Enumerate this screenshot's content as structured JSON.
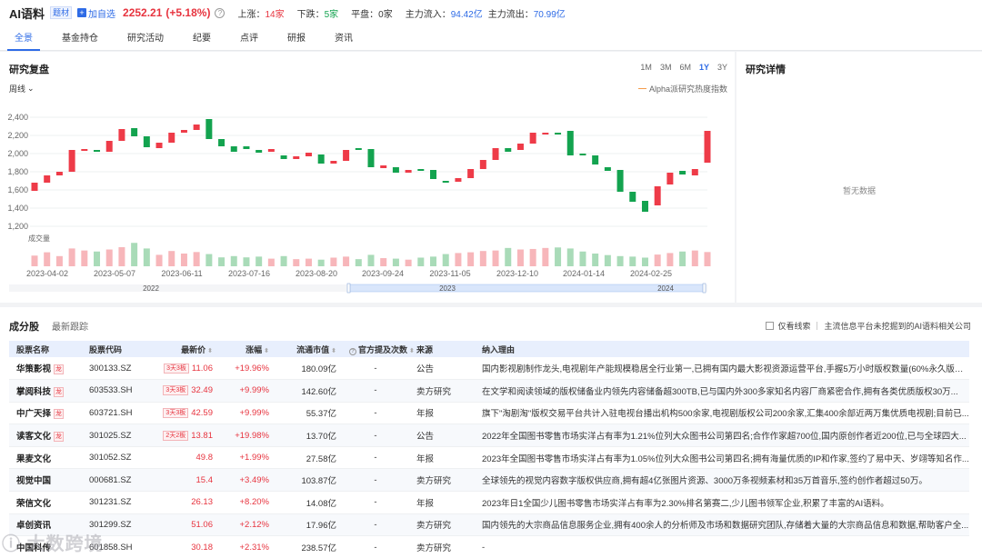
{
  "header": {
    "title": "AI语料",
    "badge": "题材",
    "add_watch": "加自选",
    "price": "2252.21",
    "change": "(+5.18%)",
    "stats": {
      "up_label": "上涨：",
      "up_value": "14家",
      "down_label": "下跌：",
      "down_value": "5家",
      "flat_label": "平盘：",
      "flat_value": "0家",
      "inflow_label": "主力流入：",
      "inflow_value": "94.42亿",
      "outflow_label": "主力流出：",
      "outflow_value": "70.99亿"
    }
  },
  "tabs": [
    "全景",
    "基金持仓",
    "研究活动",
    "纪要",
    "点评",
    "研报",
    "资讯"
  ],
  "review": {
    "title": "研究复盘",
    "period": "周线",
    "ranges": [
      "1M",
      "3M",
      "6M",
      "1Y",
      "3Y"
    ],
    "active_range": "1Y",
    "legend": "Alpha派研究热度指数",
    "volume_label": "成交量"
  },
  "detail": {
    "title": "研究详情",
    "empty": "暂无数据"
  },
  "chart_data": {
    "type": "candlestick",
    "yticks": [
      "2,400",
      "2,200",
      "2,000",
      "1,800",
      "1,600",
      "1,400",
      "1,200"
    ],
    "ylim": [
      1200,
      2400
    ],
    "xticks": [
      "2023-04-02",
      "2023-05-07",
      "2023-06-11",
      "2023-07-16",
      "2023-08-20",
      "2023-09-24",
      "2023-11-05",
      "2023-12-10",
      "2024-01-14",
      "2024-02-25"
    ],
    "years": [
      "2022",
      "2023",
      "2024"
    ],
    "candles": [
      [
        1590,
        1680
      ],
      [
        1680,
        1760
      ],
      [
        1760,
        1800
      ],
      [
        1800,
        2040
      ],
      [
        2040,
        2050
      ],
      [
        2040,
        2020
      ],
      [
        2020,
        2140
      ],
      [
        2140,
        2270
      ],
      [
        2280,
        2190
      ],
      [
        2190,
        2070
      ],
      [
        2060,
        2120
      ],
      [
        2120,
        2230
      ],
      [
        2230,
        2260
      ],
      [
        2260,
        2320
      ],
      [
        2380,
        2160
      ],
      [
        2160,
        2080
      ],
      [
        2080,
        2020
      ],
      [
        2080,
        2050
      ],
      [
        2040,
        2010
      ],
      [
        2020,
        2050
      ],
      [
        1980,
        1940
      ],
      [
        1940,
        1970
      ],
      [
        1970,
        2010
      ],
      [
        1990,
        1890
      ],
      [
        1890,
        1920
      ],
      [
        1920,
        2040
      ],
      [
        2060,
        2040
      ],
      [
        2050,
        1850
      ],
      [
        1840,
        1870
      ],
      [
        1850,
        1790
      ],
      [
        1790,
        1820
      ],
      [
        1830,
        1810
      ],
      [
        1820,
        1720
      ],
      [
        1700,
        1680
      ],
      [
        1690,
        1730
      ],
      [
        1730,
        1830
      ],
      [
        1830,
        1930
      ],
      [
        1930,
        2060
      ],
      [
        2060,
        2020
      ],
      [
        2040,
        2110
      ],
      [
        2110,
        2230
      ],
      [
        2230,
        2230
      ],
      [
        2230,
        2210
      ],
      [
        2250,
        1980
      ],
      [
        2000,
        1980
      ],
      [
        1980,
        1880
      ],
      [
        1850,
        1810
      ],
      [
        1820,
        1580
      ],
      [
        1580,
        1470
      ],
      [
        1480,
        1360
      ],
      [
        1430,
        1640
      ],
      [
        1660,
        1790
      ],
      [
        1810,
        1770
      ],
      [
        1760,
        1830
      ],
      [
        1900,
        2250
      ]
    ],
    "volumes": [
      0.42,
      0.55,
      0.4,
      0.7,
      0.62,
      0.58,
      0.66,
      0.75,
      0.92,
      0.7,
      0.45,
      0.6,
      0.5,
      0.56,
      0.48,
      0.35,
      0.4,
      0.35,
      0.38,
      0.3,
      0.4,
      0.28,
      0.3,
      0.26,
      0.34,
      0.38,
      0.28,
      0.45,
      0.32,
      0.3,
      0.26,
      0.34,
      0.38,
      0.48,
      0.52,
      0.55,
      0.6,
      0.62,
      0.72,
      0.66,
      0.68,
      0.72,
      0.74,
      0.7,
      0.58,
      0.5,
      0.44,
      0.4,
      0.38,
      0.34,
      0.46,
      0.52,
      0.58,
      0.62,
      0.56
    ]
  },
  "comp": {
    "tab_active": "成分股",
    "tab_other": "最新跟踪",
    "checkbox_label": "仅看线索",
    "filter_text": "主流信息平台未挖掘到的AI语料相关公司",
    "headers": {
      "name": "股票名称",
      "code": "股票代码",
      "price": "最新价",
      "change": "涨幅",
      "cap": "流通市值",
      "mention": "官方提及次数",
      "source": "来源",
      "reason": "纳入理由"
    },
    "rows": [
      {
        "name": "华策影视",
        "tag": "龙",
        "code": "300133.SZ",
        "boards": "3天3板",
        "price": "11.06",
        "change": "+19.96%",
        "cap": "180.09亿",
        "mention": "-",
        "source": "公告",
        "reason": "国内影视剧制作龙头,电视剧年产能规模稳居全行业第一,已拥有国内最大影视资源运营平台,手握5万小时版权数量(60%永久版权..."
      },
      {
        "name": "掌阅科技",
        "tag": "龙",
        "code": "603533.SH",
        "boards": "3天3板",
        "price": "32.49",
        "change": "+9.99%",
        "cap": "142.60亿",
        "mention": "-",
        "source": "卖方研究",
        "reason": "在文学和阅读领域的版权储备业内领先内容储备超300TB,已与国内外300多家知名内容厂商紧密合作,拥有各类优质版权30万..."
      },
      {
        "name": "中广天择",
        "tag": "龙",
        "code": "603721.SH",
        "boards": "3天3板",
        "price": "42.59",
        "change": "+9.99%",
        "cap": "55.37亿",
        "mention": "-",
        "source": "年报",
        "reason": "旗下\"淘剧淘\"版权交易平台共计入驻电视台播出机构500余家,电视剧版权公司200余家,汇集400余部近两万集优质电视剧;目前已..."
      },
      {
        "name": "读客文化",
        "tag": "龙",
        "code": "301025.SZ",
        "boards": "2天2板",
        "price": "13.81",
        "change": "+19.98%",
        "cap": "13.70亿",
        "mention": "-",
        "source": "公告",
        "reason": "2022年全国图书零售市场实洋占有率为1.21%位列大众图书公司第四名;合作作家超700位,国内原创作者近200位,已与全球四大..."
      },
      {
        "name": "果麦文化",
        "tag": "",
        "code": "301052.SZ",
        "boards": "",
        "price": "49.8",
        "change": "+1.99%",
        "cap": "27.58亿",
        "mention": "-",
        "source": "年报",
        "reason": "2023年全国图书零售市场实洋占有率为1.05%位列大众图书公司第四名;拥有海量优质的IP和作家,签约了易中天、岁翊等知名作..."
      },
      {
        "name": "视觉中国",
        "tag": "",
        "code": "000681.SZ",
        "boards": "",
        "price": "15.4",
        "change": "+3.49%",
        "cap": "103.87亿",
        "mention": "-",
        "source": "卖方研究",
        "reason": "全球领先的视觉内容数字版权供应商,拥有超4亿张图片资源、3000万条视频素材和35万首音乐,签约创作者超过50万。"
      },
      {
        "name": "荣信文化",
        "tag": "",
        "code": "301231.SZ",
        "boards": "",
        "price": "26.13",
        "change": "+8.20%",
        "cap": "14.08亿",
        "mention": "-",
        "source": "年报",
        "reason": "2023年日1全国少儿图书零售市场实洋占有率为2.30%排名第赛二,少儿图书领军企业,积累了丰富的AI语料。"
      },
      {
        "name": "卓创资讯",
        "tag": "",
        "code": "301299.SZ",
        "boards": "",
        "price": "51.06",
        "change": "+2.12%",
        "cap": "17.96亿",
        "mention": "-",
        "source": "卖方研究",
        "reason": "国内领先的大宗商品信息服务企业,拥有400余人的分析师及市场和数据研究团队,存储着大量的大宗商品信息和数据,帮助客户全..."
      },
      {
        "name": "中国科传",
        "tag": "",
        "code": "601858.SH",
        "boards": "",
        "price": "30.18",
        "change": "+2.31%",
        "cap": "238.57亿",
        "mention": "-",
        "source": "卖方研究",
        "reason": "-"
      }
    ]
  },
  "watermark": "大数跨境"
}
